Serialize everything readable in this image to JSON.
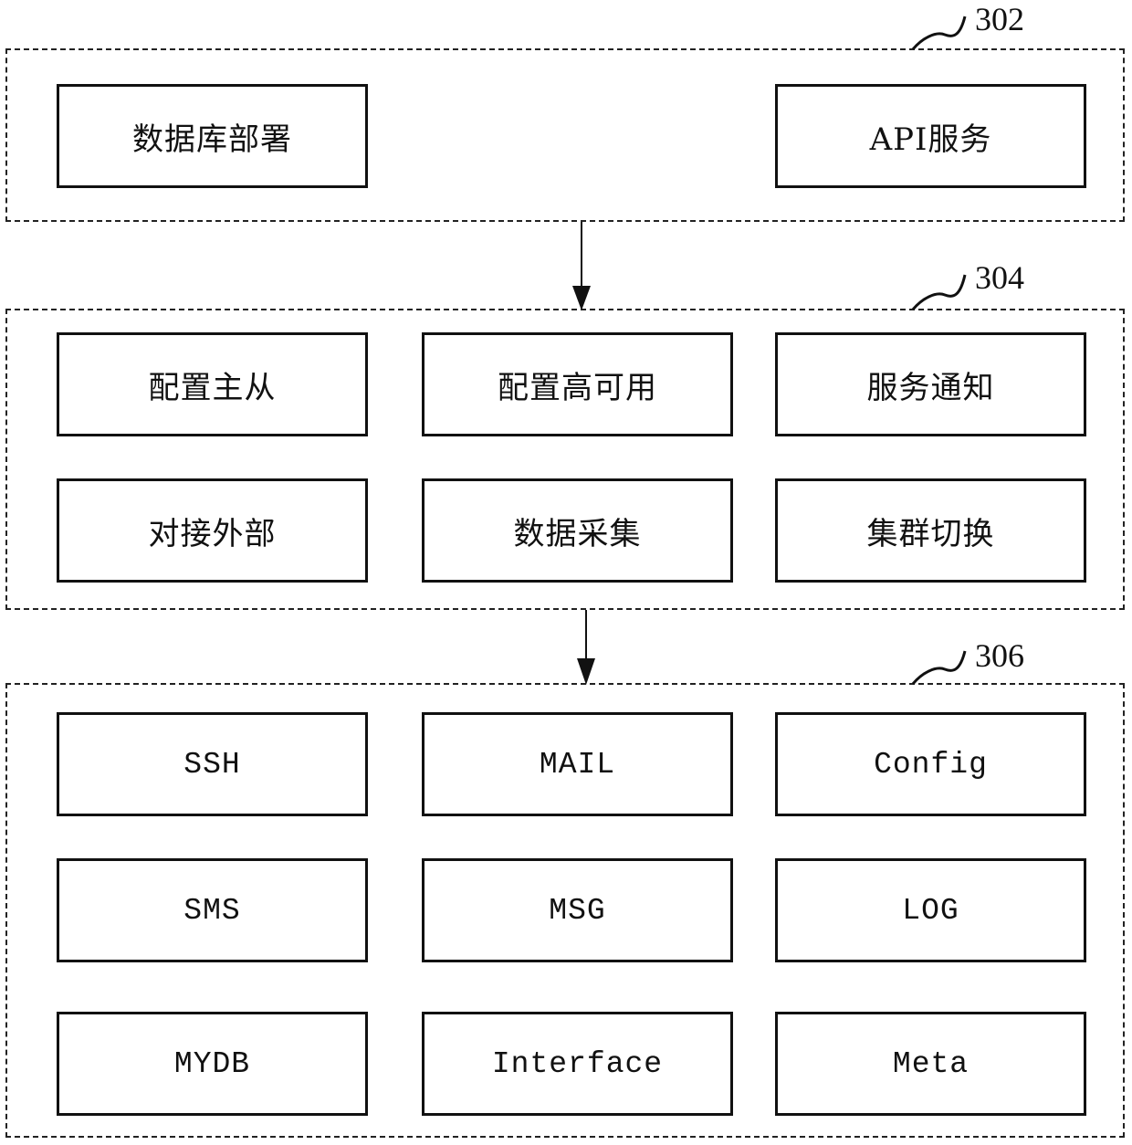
{
  "groups": [
    {
      "ref": "302",
      "nodes": [
        "数据库部署",
        "API服务"
      ]
    },
    {
      "ref": "304",
      "nodes": [
        "配置主从",
        "配置高可用",
        "服务通知",
        "对接外部",
        "数据采集",
        "集群切换"
      ]
    },
    {
      "ref": "306",
      "nodes": [
        "SSH",
        "MAIL",
        "Config",
        "SMS",
        "MSG",
        "LOG",
        "MYDB",
        "Interface",
        "Meta"
      ]
    }
  ],
  "edges": [
    {
      "from": "302",
      "to": "304"
    },
    {
      "from": "304",
      "to": "306"
    }
  ]
}
